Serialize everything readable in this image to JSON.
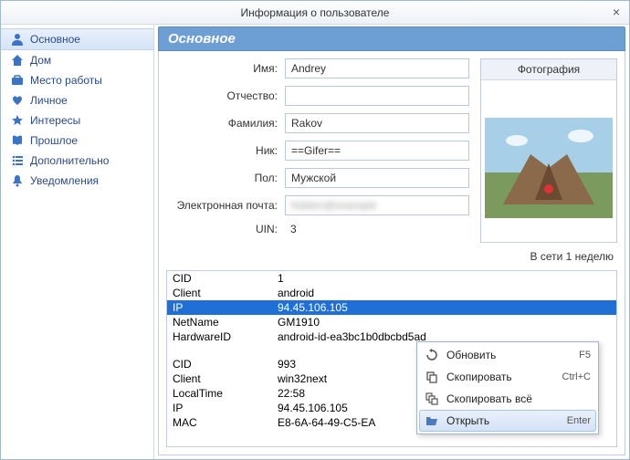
{
  "window": {
    "title": "Информация о пользователе"
  },
  "sidebar": {
    "items": [
      {
        "label": "Основное"
      },
      {
        "label": "Дом"
      },
      {
        "label": "Место работы"
      },
      {
        "label": "Личное"
      },
      {
        "label": "Интересы"
      },
      {
        "label": "Прошлое"
      },
      {
        "label": "Дополнительно"
      },
      {
        "label": "Уведомления"
      }
    ]
  },
  "section": {
    "header": "Основное"
  },
  "form": {
    "name_label": "Имя:",
    "name_value": "Andrey",
    "middle_label": "Отчество:",
    "middle_value": "",
    "last_label": "Фамилия:",
    "last_value": "Rakov",
    "nick_label": "Ник:",
    "nick_value": "==Gifer==",
    "gender_label": "Пол:",
    "gender_value": "Мужской",
    "email_label": "Электронная почта:",
    "email_value": "hidden@example",
    "uin_label": "UIN:",
    "uin_value": "3"
  },
  "photo": {
    "header": "Фотография"
  },
  "status": {
    "text": "В сети 1 неделю"
  },
  "kv": {
    "rows": [
      {
        "k": "CID",
        "v": "1"
      },
      {
        "k": "Client",
        "v": "android"
      },
      {
        "k": "IP",
        "v": "94.45.106.105",
        "sel": true
      },
      {
        "k": "NetName",
        "v": "GM1910"
      },
      {
        "k": "HardwareID",
        "v": "android-id-ea3bc1b0dbcbd5ad"
      },
      {
        "blank": true
      },
      {
        "k": "CID",
        "v": "993"
      },
      {
        "k": "Client",
        "v": "win32next"
      },
      {
        "k": "LocalTime",
        "v": "22:58"
      },
      {
        "k": "IP",
        "v": "94.45.106.105"
      },
      {
        "k": "MAC",
        "v": "E8-6A-64-49-C5-EA"
      }
    ]
  },
  "context_menu": {
    "refresh": {
      "label": "Обновить",
      "shortcut": "F5"
    },
    "copy": {
      "label": "Скопировать",
      "shortcut": "Ctrl+C"
    },
    "copy_all": {
      "label": "Скопировать всё",
      "shortcut": ""
    },
    "open": {
      "label": "Открыть",
      "shortcut": "Enter"
    }
  }
}
